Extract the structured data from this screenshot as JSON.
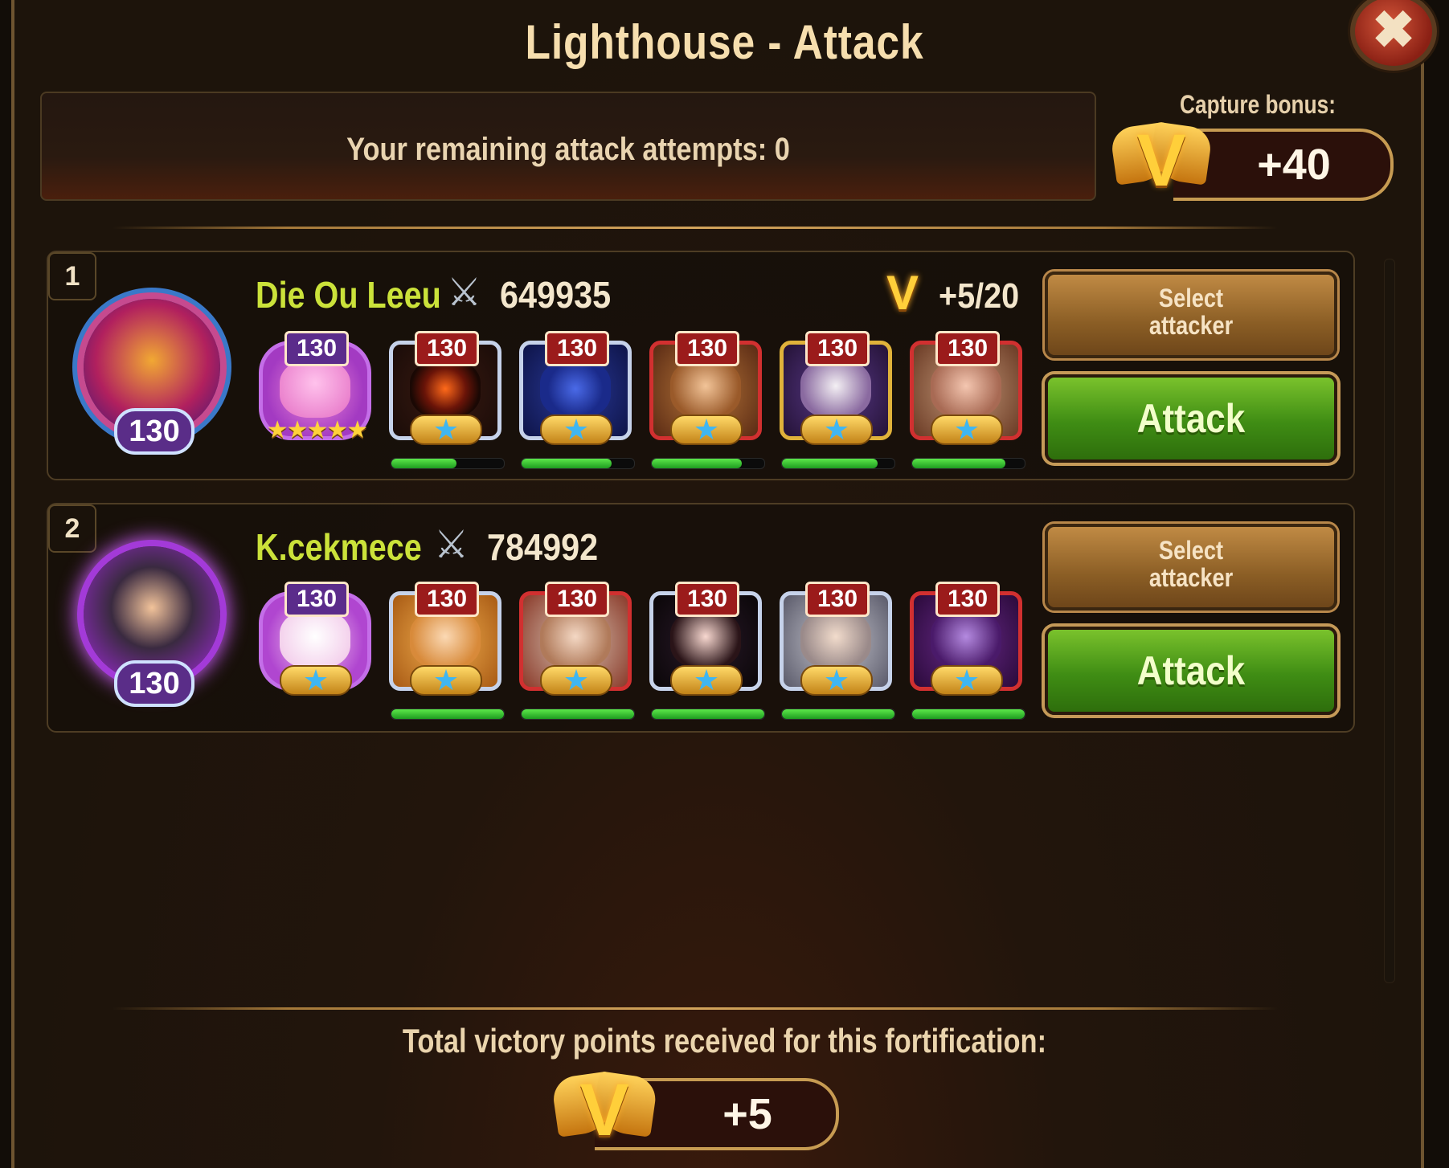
{
  "window": {
    "title": "Lighthouse - Attack",
    "close_glyph": "✖"
  },
  "attempts": {
    "text": "Your remaining attack attempts: 0"
  },
  "capture": {
    "label": "Capture bonus:",
    "value": "+40",
    "icon": "victory-points-icon"
  },
  "opponents": [
    {
      "rank": "1",
      "name": "Die Ou Leeu",
      "power": "649935",
      "level": "130",
      "points": "+5/20",
      "select_label": "Select\nattacker",
      "attack_label": "Attack",
      "pet": {
        "level": "130",
        "stars": "★★★★★"
      },
      "heroes": [
        {
          "level": "130",
          "star": "★",
          "hp": 0.58
        },
        {
          "level": "130",
          "star": "★",
          "hp": 0.8
        },
        {
          "level": "130",
          "star": "★",
          "hp": 0.8
        },
        {
          "level": "130",
          "star": "★",
          "hp": 0.85
        },
        {
          "level": "130",
          "star": "★",
          "hp": 0.83
        }
      ]
    },
    {
      "rank": "2",
      "name": "K.cekmece",
      "power": "784992",
      "level": "130",
      "points": "",
      "select_label": "Select\nattacker",
      "attack_label": "Attack",
      "pet": {
        "level": "130",
        "star": "★"
      },
      "heroes": [
        {
          "level": "130",
          "star": "★",
          "hp": 1.0
        },
        {
          "level": "130",
          "star": "★",
          "hp": 1.0
        },
        {
          "level": "130",
          "star": "★",
          "hp": 1.0
        },
        {
          "level": "130",
          "star": "★",
          "hp": 1.0
        },
        {
          "level": "130",
          "star": "★",
          "hp": 1.0
        }
      ]
    }
  ],
  "total": {
    "label": "Total victory points received for this fortification:",
    "value": "+5"
  },
  "colors": {
    "player_name": "#cbe23a",
    "attack_button": "#4f9e1a",
    "select_button": "#a8743a",
    "hp_bar": "#3ccf34"
  },
  "symbols": {
    "swords": "⚔",
    "victory_letter": "V"
  }
}
